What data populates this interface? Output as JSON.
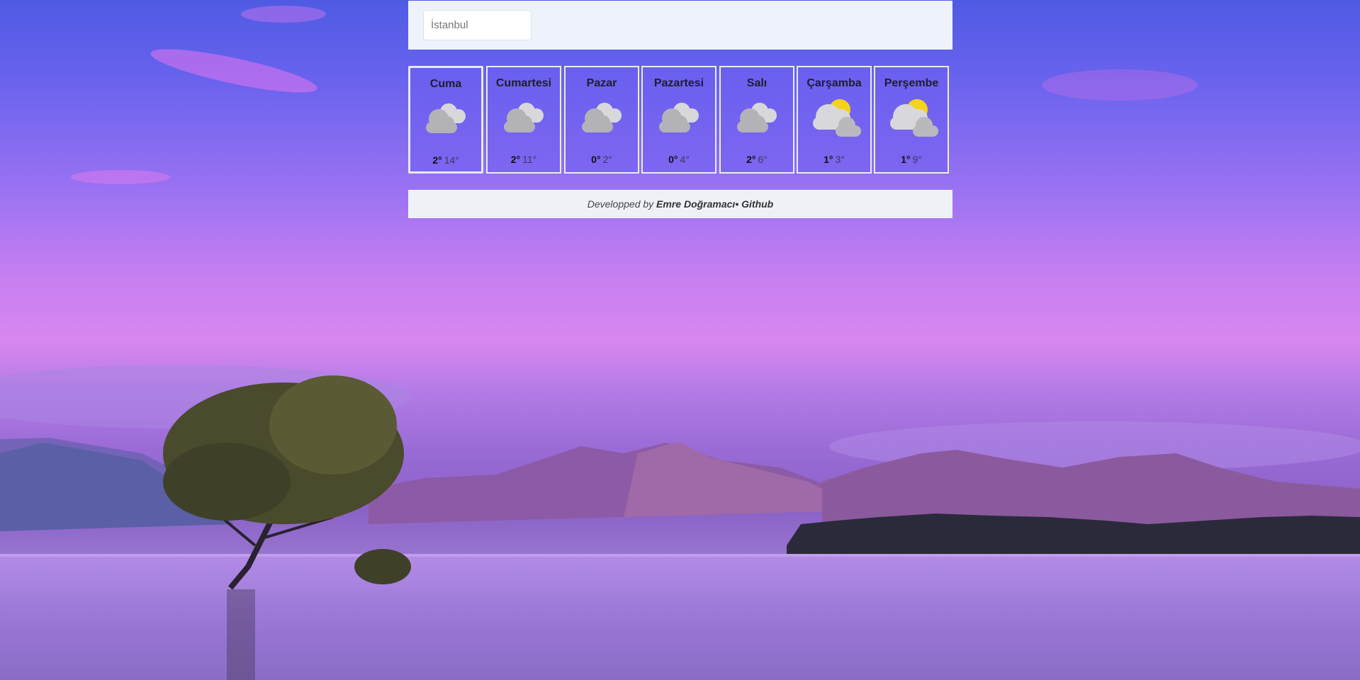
{
  "search": {
    "placeholder": "İstanbul",
    "value": ""
  },
  "forecast": [
    {
      "day": "Cuma",
      "icon": "cloudy-icon",
      "min": "2°",
      "max": "14°",
      "active": true
    },
    {
      "day": "Cumartesi",
      "icon": "cloudy-icon",
      "min": "2°",
      "max": "11°"
    },
    {
      "day": "Pazar",
      "icon": "cloudy-icon",
      "min": "0°",
      "max": "2°"
    },
    {
      "day": "Pazartesi",
      "icon": "cloudy-icon",
      "min": "0°",
      "max": "4°"
    },
    {
      "day": "Salı",
      "icon": "cloudy-icon",
      "min": "2°",
      "max": "6°"
    },
    {
      "day": "Çarşamba",
      "icon": "partly-sunny-icon",
      "min": "1°",
      "max": "3°"
    },
    {
      "day": "Perşembe",
      "icon": "partly-sunny-icon",
      "min": "1°",
      "max": "9°"
    }
  ],
  "footer": {
    "prefix": "Developped by",
    "author": "Emre Doğramacı",
    "separator": "•",
    "github": "Github"
  },
  "colors": {
    "panel": "#eef3fb",
    "card_border": "#e9ecf4",
    "sun": "#f5d31a",
    "cloud": "#b9b9bd"
  }
}
